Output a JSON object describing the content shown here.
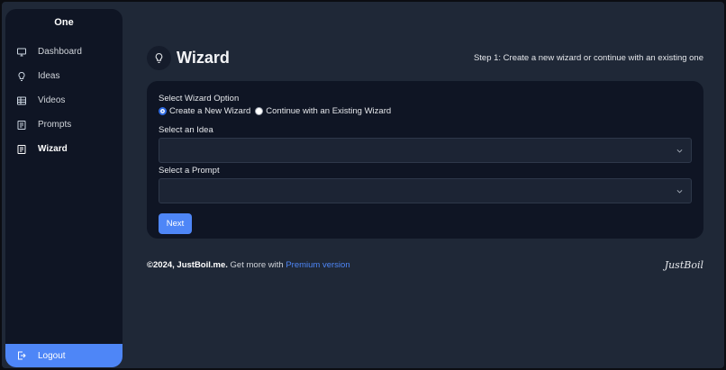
{
  "sidebar": {
    "brand": "One",
    "items": [
      {
        "label": "Dashboard",
        "icon": "monitor-icon",
        "active": false
      },
      {
        "label": "Ideas",
        "icon": "lightbulb-icon",
        "active": false
      },
      {
        "label": "Videos",
        "icon": "table-icon",
        "active": false
      },
      {
        "label": "Prompts",
        "icon": "document-icon",
        "active": false
      },
      {
        "label": "Wizard",
        "icon": "document-icon",
        "active": true
      }
    ],
    "logout_label": "Logout"
  },
  "header": {
    "title": "Wizard",
    "step_text": "Step 1: Create a new wizard or continue with an existing one"
  },
  "form": {
    "option_label": "Select Wizard Option",
    "option_new": "Create a New Wizard",
    "option_existing": "Continue with an Existing Wizard",
    "selected_option": "new",
    "idea_label": "Select an Idea",
    "idea_value": "",
    "prompt_label": "Select a Prompt",
    "prompt_value": "",
    "next_label": "Next"
  },
  "footer": {
    "copyright": "©2024, JustBoil.me.",
    "get_more": " Get more with ",
    "premium_link": "Premium version",
    "logo_text": "JustBoil"
  },
  "colors": {
    "accent": "#4e86f7",
    "background": "#1f2837",
    "panel": "#0f1524"
  }
}
